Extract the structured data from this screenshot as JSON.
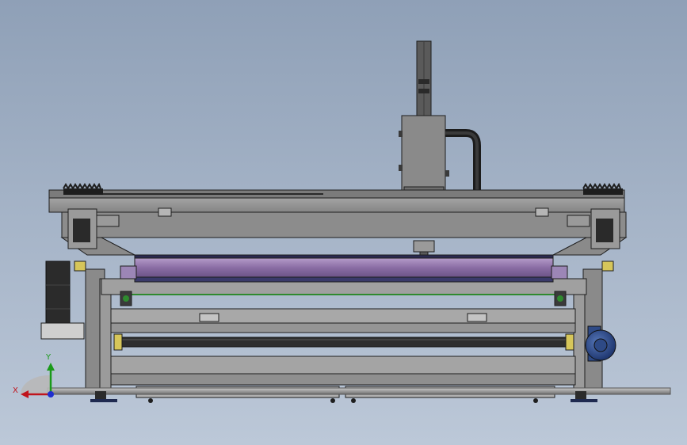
{
  "viewport": {
    "background_top": "#8fa0b7",
    "background_bottom": "#bcc8d8"
  },
  "triad": {
    "x_label": "X",
    "y_label": "Y",
    "x_color": "#c0141c",
    "y_color": "#1a9a1a",
    "z_color": "#1f2fd0"
  },
  "model": {
    "frame_color": "#8f8f8f",
    "edge_color": "#1e1e1e",
    "roller_color": "#9a7fb0",
    "motor_color": "#2e4a86",
    "dark_part_color": "#2b2b2b",
    "accent_color": "#d6c65a"
  }
}
